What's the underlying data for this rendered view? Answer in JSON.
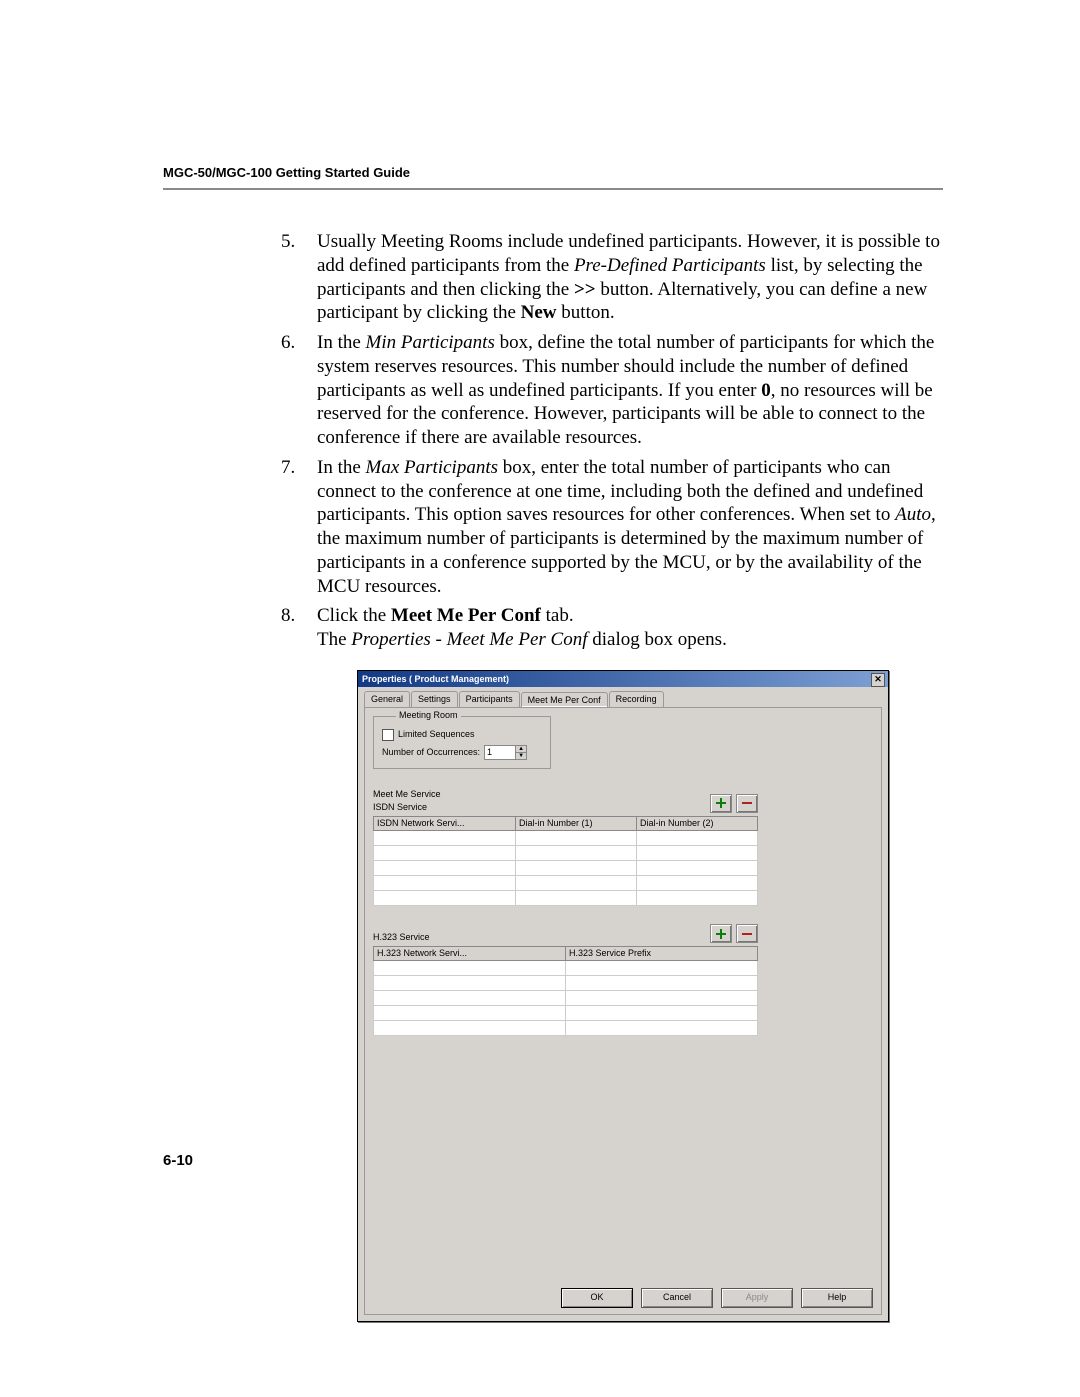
{
  "header": "MGC-50/MGC-100 Getting Started Guide",
  "steps": {
    "s5": {
      "pre": "Usually Meeting Rooms include undefined participants. However, it is possible to add defined participants from the ",
      "em1": "Pre-Defined Participants",
      "mid1": " list, by selecting the participants and then clicking the ",
      "b1": ">>",
      "mid2": " button. Alternatively, you can define a new participant by clicking the ",
      "b2": "New",
      "post": " button."
    },
    "s6": {
      "pre": "In the ",
      "em1": "Min Participants",
      "mid1": " box, define the total number of participants for which the system reserves resources. This number should include the number of defined participants as well as undefined participants. If you enter ",
      "b1": "0",
      "post": ", no resources will be reserved for the conference. However, participants will be able to connect to the conference if there are available resources."
    },
    "s7": {
      "pre": "In the ",
      "em1": "Max Participants",
      "mid1": " box, enter the total number of participants who can connect to the conference at one time, including both the defined and undefined participants. This option saves resources for other conferences. When set to ",
      "em2": "Auto",
      "post": ", the maximum number of participants is determined by the maximum number of participants in a conference supported by the MCU, or by the availability of the MCU resources."
    },
    "s8": {
      "line1_pre": "Click the ",
      "line1_b": "Meet Me Per Conf",
      "line1_post": " tab.",
      "line2_pre": "The ",
      "line2_em": "Properties - Meet Me Per Conf",
      "line2_post": " dialog box opens."
    }
  },
  "dialog": {
    "title": "Properties ( Product Management)",
    "tabs": [
      "General",
      "Settings",
      "Participants",
      "Meet Me Per Conf",
      "Recording"
    ],
    "active_tab": "Meet Me Per Conf",
    "group": {
      "legend": "Meeting Room",
      "limited_label": "Limited Sequences",
      "occ_label": "Number of Occurrences:",
      "occ_value": "1"
    },
    "meet_me_label": "Meet Me Service",
    "isdn": {
      "label": "ISDN Service",
      "cols": [
        "ISDN Network Servi...",
        "Dial-in Number (1)",
        "Dial-in Number (2)"
      ]
    },
    "h323": {
      "label": "H.323 Service",
      "cols": [
        "H.323 Network Servi...",
        "H.323 Service Prefix"
      ]
    },
    "buttons": {
      "ok": "OK",
      "cancel": "Cancel",
      "apply": "Apply",
      "help": "Help"
    }
  },
  "page_number": "6-10"
}
